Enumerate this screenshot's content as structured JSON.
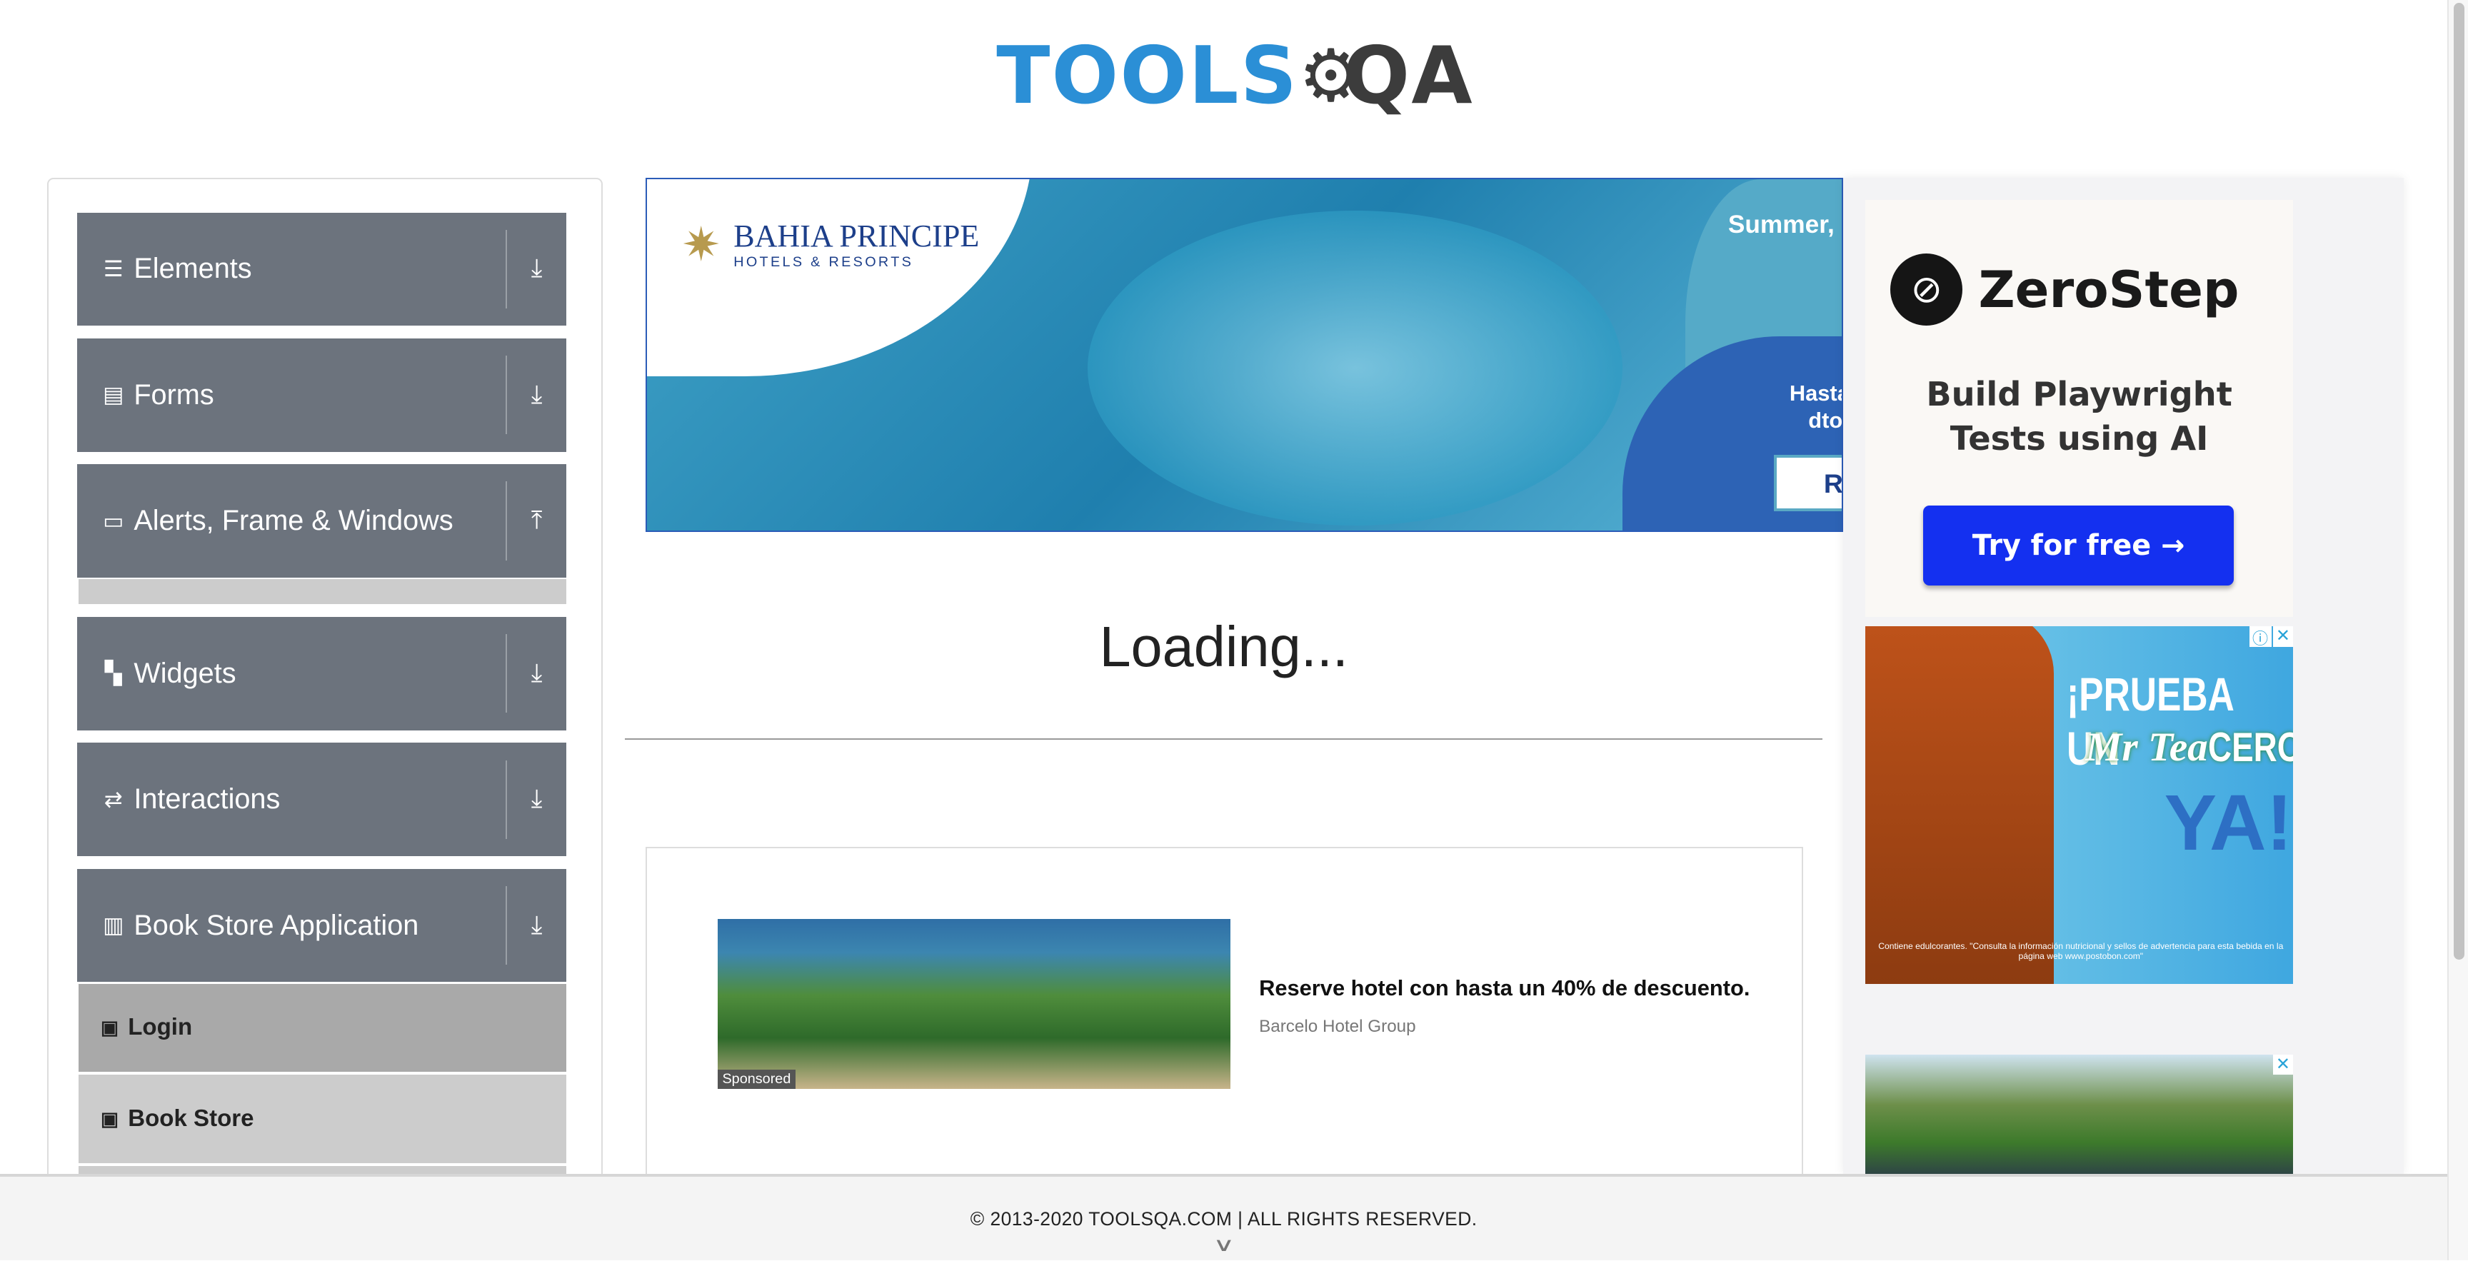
{
  "logo": {
    "part1": "TOOLS",
    "part2": "QA"
  },
  "sidebar": {
    "groups": [
      {
        "label": "Elements",
        "icon": "menu-icon",
        "arrow": "download-icon"
      },
      {
        "label": "Forms",
        "icon": "document-icon",
        "arrow": "download-icon"
      },
      {
        "label": "Alerts, Frame & Windows",
        "icon": "window-icon",
        "arrow": "upload-icon"
      },
      {
        "label": "Widgets",
        "icon": "widgets-icon",
        "arrow": "download-icon"
      },
      {
        "label": "Interactions",
        "icon": "interactions-icon",
        "arrow": "download-icon"
      },
      {
        "label": "Book Store Application",
        "icon": "books-icon",
        "arrow": "download-icon"
      }
    ],
    "subitems": [
      {
        "label": "Login"
      },
      {
        "label": "Book Store"
      }
    ]
  },
  "banner": {
    "brand": "BAHIA PRINCIPE",
    "brand_sub": "HOTELS & RESORTS",
    "headline": "Summer,",
    "offer_line1": "Hasta",
    "offer_line2": "dto",
    "cta": "Re"
  },
  "main": {
    "loading": "Loading..."
  },
  "native_ad": {
    "title": "Reserve hotel con hasta un 40% de descuento.",
    "advertiser": "Barcelo Hotel Group",
    "sponsored": "Sponsored"
  },
  "ads": {
    "zerostep": {
      "brand": "ZeroStep",
      "line1": "Build Playwright",
      "line2": "Tests using AI",
      "cta": "Try for free →"
    },
    "tea": {
      "headline1": "¡PRUEBA UN",
      "brand": "Mr Tea",
      "headline2": "CERO",
      "headline3": "YA!",
      "disclaimer": "Contiene edulcorantes. \"Consulta la información nutricional y sellos de advertencia para esta bebida en la página web www.postobon.com\""
    }
  },
  "footer": {
    "copyright": "© 2013-2020 TOOLSQA.COM | ALL RIGHTS RESERVED."
  },
  "colors": {
    "group_bg": "#6c737d",
    "login_bg": "#a9a9a9",
    "bookstore_bg": "#cccccc",
    "zerostep_cta": "#1430f0",
    "logo_blue": "#2b8fd6"
  }
}
